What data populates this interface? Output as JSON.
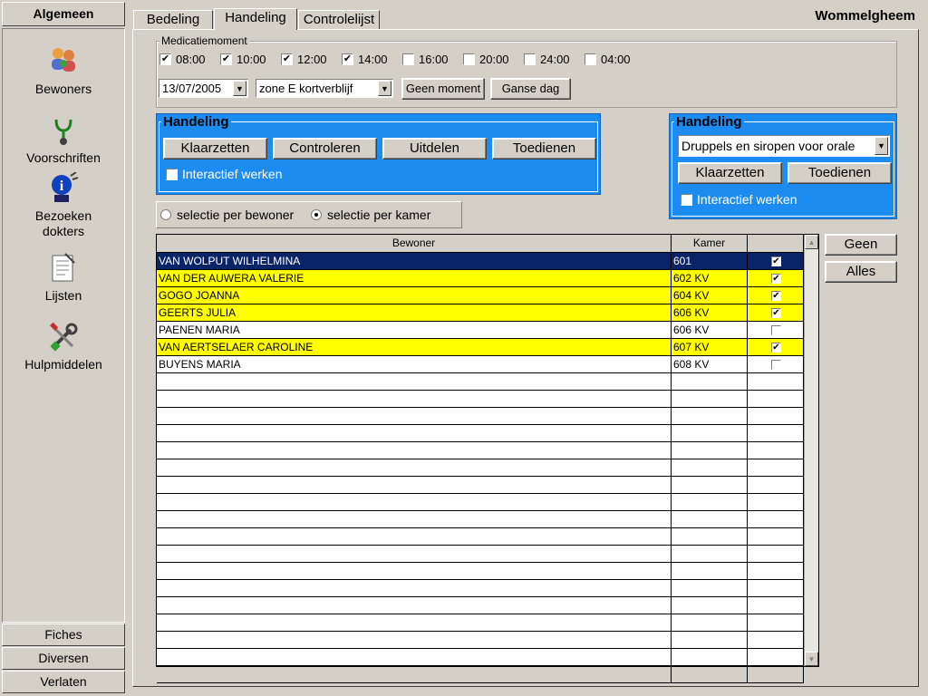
{
  "sidebar": {
    "title": "Algemeen",
    "items": [
      {
        "label": "Bewoners",
        "icon": "people-icon"
      },
      {
        "label": "Voorschriften",
        "icon": "stethoscope-icon"
      },
      {
        "label": "Bezoeken dokters",
        "icon": "info-person-icon"
      },
      {
        "label": "Lijsten",
        "icon": "document-list-icon"
      },
      {
        "label": "Hulpmiddelen",
        "icon": "tools-icon"
      }
    ],
    "footer": [
      "Fiches",
      "Diversen",
      "Verlaten"
    ]
  },
  "tabs": [
    "Bedeling",
    "Handeling",
    "Controlelijst"
  ],
  "active_tab": "Handeling",
  "org_name": "Wommelgheem",
  "medicatie": {
    "legend": "Medicatiemoment",
    "times": [
      {
        "label": "08:00",
        "checked": true
      },
      {
        "label": "10:00",
        "checked": true
      },
      {
        "label": "12:00",
        "checked": true
      },
      {
        "label": "14:00",
        "checked": true
      },
      {
        "label": "16:00",
        "checked": false
      },
      {
        "label": "20:00",
        "checked": false
      },
      {
        "label": "24:00",
        "checked": false
      },
      {
        "label": "04:00",
        "checked": false
      }
    ],
    "date": "13/07/2005",
    "zone": "zone E kortverblijf",
    "btn_geen_moment": "Geen moment",
    "btn_ganse_dag": "Ganse dag"
  },
  "handeling_left": {
    "title": "Handeling",
    "buttons": [
      "Klaarzetten",
      "Controleren",
      "Uitdelen",
      "Toedienen"
    ],
    "interactief_label": "Interactief werken",
    "interactief_checked": true
  },
  "handeling_right": {
    "title": "Handeling",
    "select_value": "Druppels en siropen voor orale",
    "buttons": [
      "Klaarzetten",
      "Toedienen"
    ],
    "interactief_label": "Interactief werken",
    "interactief_checked": false
  },
  "selectie": {
    "per_bewoner": "selectie per bewoner",
    "per_kamer": "selectie per kamer",
    "selected": "per_kamer"
  },
  "grid": {
    "headers": [
      "Bewoner",
      "Kamer",
      ""
    ],
    "rows": [
      {
        "name": "VAN WOLPUT WILHELMINA",
        "kamer": "601",
        "checked": true,
        "style": "selected"
      },
      {
        "name": "VAN DER AUWERA VALERIE",
        "kamer": "602 KV",
        "checked": true,
        "style": "yellow"
      },
      {
        "name": "GOGO JOANNA",
        "kamer": "604 KV",
        "checked": true,
        "style": "yellow"
      },
      {
        "name": "GEERTS JULIA",
        "kamer": "606 KV",
        "checked": true,
        "style": "yellow"
      },
      {
        "name": "PAENEN MARIA",
        "kamer": "606 KV",
        "checked": false,
        "style": "white"
      },
      {
        "name": "VAN AERTSELAER CAROLINE",
        "kamer": "607 KV",
        "checked": true,
        "style": "yellow"
      },
      {
        "name": "BUYENS MARIA",
        "kamer": "608 KV",
        "checked": false,
        "style": "white"
      }
    ],
    "empty_rows": 18
  },
  "side_buttons": [
    "Geen",
    "Alles"
  ],
  "colors": {
    "highlight": "#ffff00",
    "selected": "#0a246a",
    "panel_blue": "#1c8cf0"
  }
}
